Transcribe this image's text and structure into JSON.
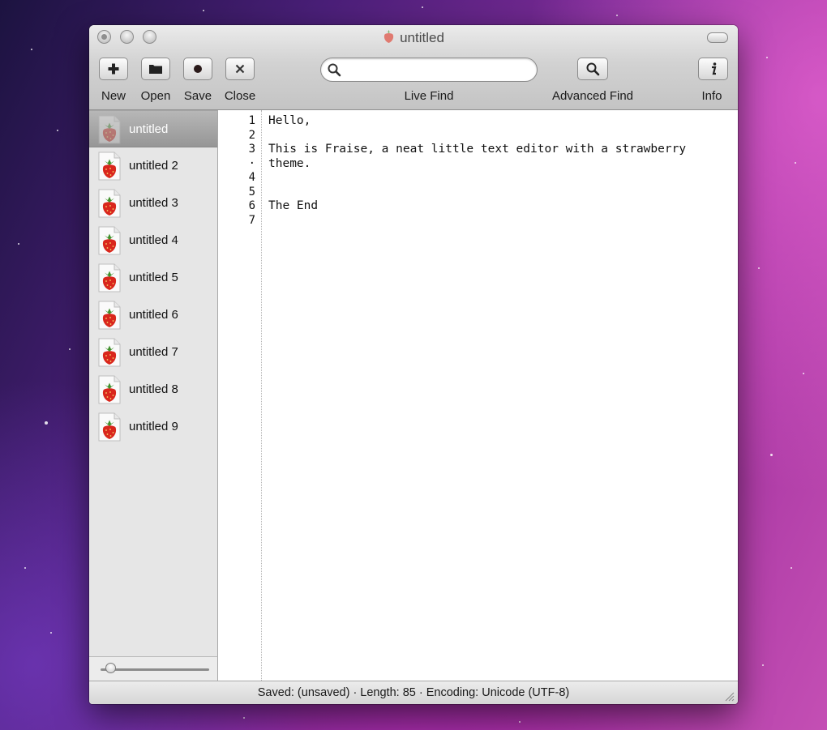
{
  "window": {
    "title": "untitled",
    "proxy_icon": "strawberry-icon"
  },
  "toolbar": {
    "new_label": "New",
    "open_label": "Open",
    "save_label": "Save",
    "close_label": "Close",
    "live_find_label": "Live Find",
    "live_find_value": "",
    "advanced_find_label": "Advanced Find",
    "info_label": "Info",
    "icons": {
      "new": "plus-icon",
      "open": "folder-icon",
      "save": "dot-icon",
      "close": "x-icon",
      "search": "magnifier-icon",
      "advanced_find": "magnifier-icon",
      "info": "info-icon"
    }
  },
  "sidebar": {
    "items": [
      {
        "label": "untitled",
        "selected": true
      },
      {
        "label": "untitled 2",
        "selected": false
      },
      {
        "label": "untitled 3",
        "selected": false
      },
      {
        "label": "untitled 4",
        "selected": false
      },
      {
        "label": "untitled 5",
        "selected": false
      },
      {
        "label": "untitled 6",
        "selected": false
      },
      {
        "label": "untitled 7",
        "selected": false
      },
      {
        "label": "untitled 8",
        "selected": false
      },
      {
        "label": "untitled 9",
        "selected": false
      }
    ]
  },
  "editor": {
    "line_numbers": [
      "1",
      "2",
      "3",
      "·",
      "4",
      "5",
      "6",
      "7"
    ],
    "lines": [
      "Hello,",
      "",
      "This is Fraise, a neat little text editor with a strawberry",
      "theme.",
      "",
      "",
      "The End",
      ""
    ]
  },
  "status": {
    "text": "Saved: (unsaved)  ·  Length: 85  ·  Encoding: Unicode (UTF-8)"
  },
  "colors": {
    "strawberry_red": "#d9261c",
    "leaf_green": "#3f8f2a",
    "selection_gray": "#a6a6a6"
  }
}
